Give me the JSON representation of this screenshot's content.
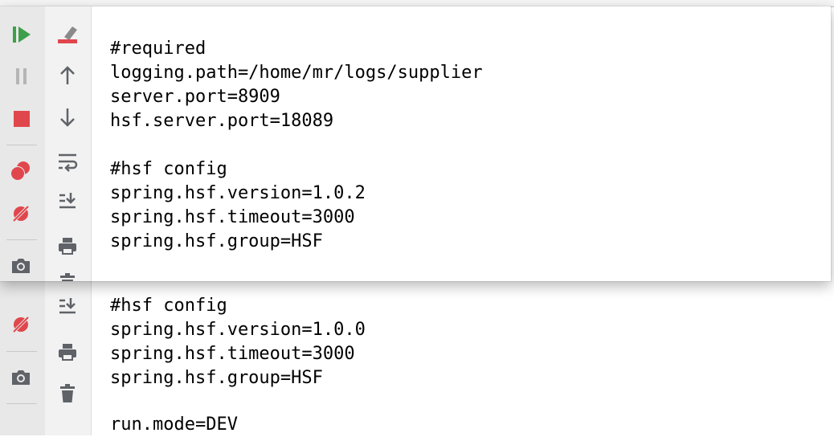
{
  "colors": {
    "run_green": "#3e9f4b",
    "stop_red": "#e0474c",
    "icon_gray": "#5f6368",
    "disabled_gray": "#b5b5b5"
  },
  "toolbar_left": [
    {
      "name": "rerun-icon",
      "icon": "play-step"
    },
    {
      "name": "pause-icon",
      "icon": "pause"
    },
    {
      "name": "stop-icon",
      "icon": "stop-square"
    },
    {
      "name": "view-breakpoints-icon",
      "icon": "red-circles"
    },
    {
      "name": "mute-breakpoints-icon",
      "icon": "slashed-circle"
    },
    {
      "name": "screenshot-icon",
      "icon": "camera"
    }
  ],
  "toolbar_mid": [
    {
      "name": "clear-all-icon",
      "icon": "eraser"
    },
    {
      "name": "up-arrow-icon",
      "icon": "arrow-up"
    },
    {
      "name": "down-arrow-icon",
      "icon": "arrow-down"
    },
    {
      "name": "soft-wrap-icon",
      "icon": "wrap"
    },
    {
      "name": "scroll-to-end-icon",
      "icon": "scroll-end"
    },
    {
      "name": "print-icon",
      "icon": "printer"
    },
    {
      "name": "trash-icon",
      "icon": "trash"
    }
  ],
  "popup": {
    "lines": [
      "#required",
      "logging.path=/home/mr/logs/supplier",
      "server.port=8909",
      "hsf.server.port=18089",
      "",
      "#hsf config",
      "spring.hsf.version=1.0.2",
      "spring.hsf.timeout=3000",
      "spring.hsf.group=HSF"
    ]
  },
  "editor": {
    "lines": [
      "#hsf config",
      "spring.hsf.version=1.0.0",
      "spring.hsf.timeout=3000",
      "spring.hsf.group=HSF",
      "",
      "run.mode=DEV"
    ]
  }
}
